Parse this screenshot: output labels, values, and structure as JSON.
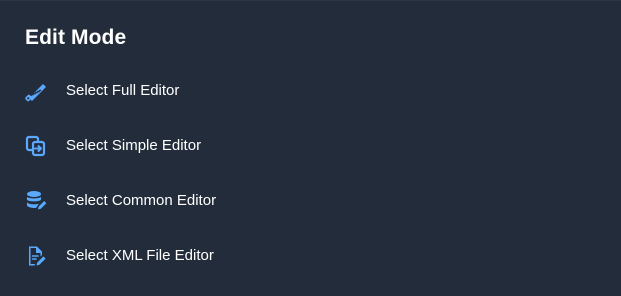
{
  "dialog": {
    "title": "Edit Mode",
    "accent_color": "#5aa9ff",
    "items": [
      {
        "label": "Select Full Editor",
        "icon": "saw-icon"
      },
      {
        "label": "Select Simple Editor",
        "icon": "copy-arrow-icon"
      },
      {
        "label": "Select Common Editor",
        "icon": "database-edit-icon"
      },
      {
        "label": "Select XML File Editor",
        "icon": "file-edit-icon"
      }
    ]
  }
}
